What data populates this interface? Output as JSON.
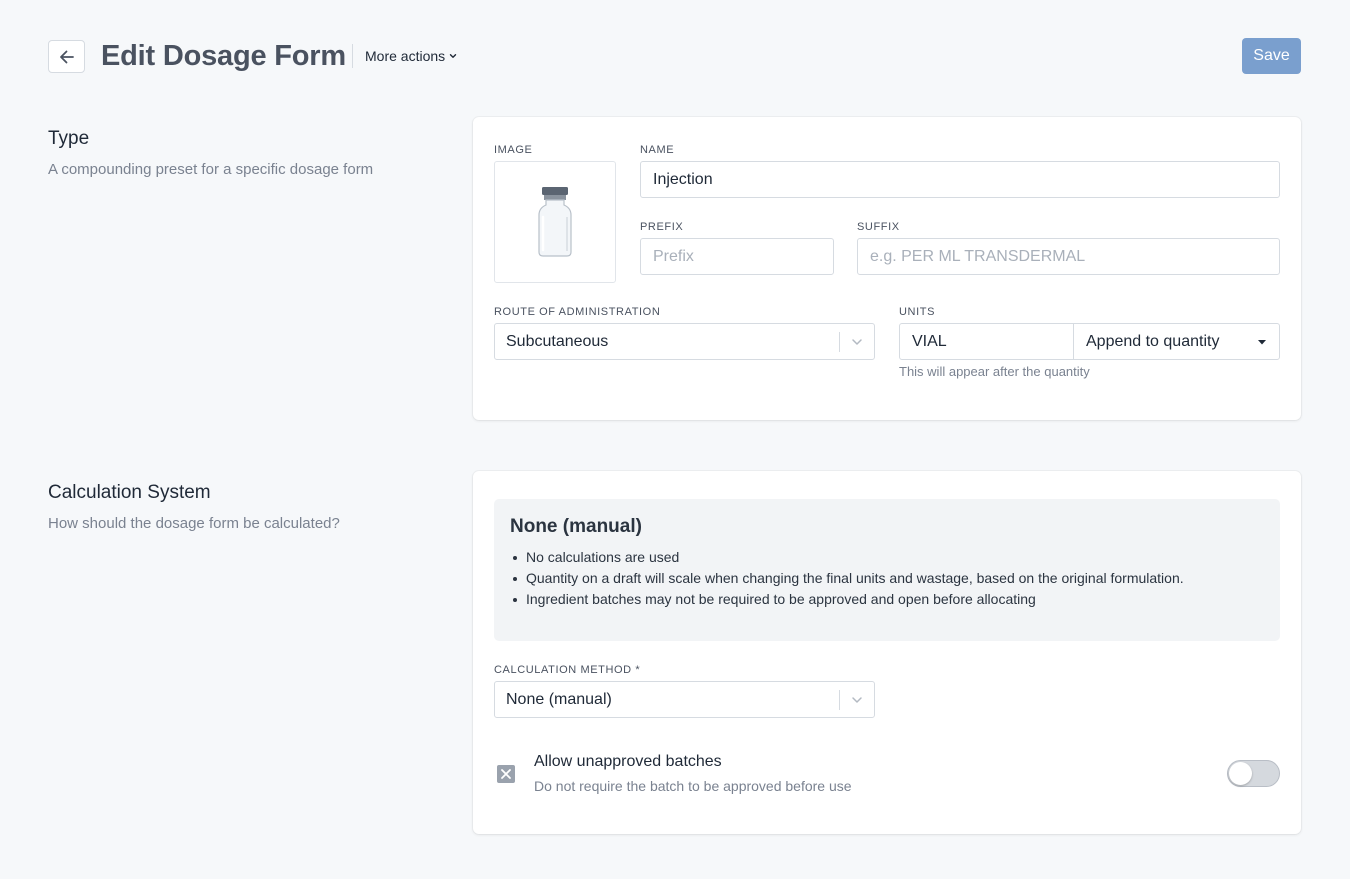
{
  "header": {
    "title": "Edit Dosage Form",
    "more_actions_label": "More actions",
    "save_label": "Save"
  },
  "type_section": {
    "title": "Type",
    "description": "A compounding preset for a specific dosage form",
    "image_label": "IMAGE",
    "name_label": "NAME",
    "name_value": "Injection",
    "prefix_label": "PREFIX",
    "prefix_placeholder": "Prefix",
    "suffix_label": "SUFFIX",
    "suffix_placeholder": "e.g. PER ML TRANSDERMAL",
    "route_label": "ROUTE OF ADMINISTRATION",
    "route_value": "Subcutaneous",
    "units_label": "UNITS",
    "units_value": "VIAL",
    "units_mode": "Append to quantity",
    "units_helper": "This will appear after the quantity"
  },
  "calc_section": {
    "title": "Calculation System",
    "description": "How should the dosage form be calculated?",
    "info_title": "None (manual)",
    "info_items": [
      "No calculations are used",
      "Quantity on a draft will scale when changing the final units and wastage, based on the original formulation.",
      "Ingredient batches may not be required to be approved and open before allocating"
    ],
    "method_label": "CALCULATION METHOD *",
    "method_value": "None (manual)",
    "allow_title": "Allow unapproved batches",
    "allow_desc": "Do not require the batch to be approved before use",
    "allow_enabled": false
  },
  "colors": {
    "save_button": "#7a9fce",
    "background": "#f6f8fa",
    "card": "#ffffff",
    "info_box": "#f2f4f6"
  },
  "icons": [
    "back-arrow-icon",
    "chevron-down-icon",
    "vial-image",
    "caret-down-icon",
    "x-square-icon"
  ]
}
